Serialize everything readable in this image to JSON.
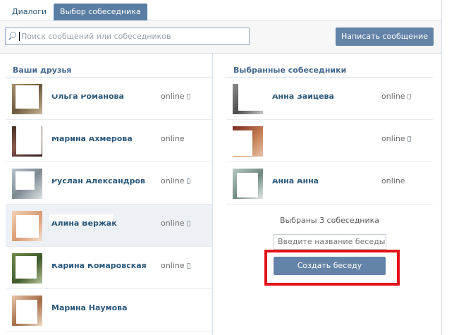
{
  "tabs": [
    {
      "label": "Диалоги",
      "active": false
    },
    {
      "label": "Выбор собеседника",
      "active": true
    }
  ],
  "search": {
    "placeholder": "Поиск сообщений или собеседников"
  },
  "toolbar": {
    "write_label": "Написать сообщение"
  },
  "friends": {
    "heading": "Ваши друзья",
    "items": [
      {
        "name": "Ольга Романова",
        "status": "online",
        "mobile": true,
        "selected": false
      },
      {
        "name": "Марина Ахмерова",
        "status": "online",
        "mobile": false,
        "selected": false
      },
      {
        "name": "Руслан Александров",
        "status": "online",
        "mobile": true,
        "selected": false
      },
      {
        "name": "Алина Вержак",
        "status": "online",
        "mobile": true,
        "selected": true
      },
      {
        "name": "Карина Комаровская",
        "status": "online",
        "mobile": true,
        "selected": false
      },
      {
        "name": "Марина Наумова",
        "status": "",
        "mobile": false,
        "selected": false
      }
    ]
  },
  "selected": {
    "heading": "Выбранные собеседники",
    "items": [
      {
        "name": "Анна Зайцева",
        "status": "online",
        "mobile": true
      },
      {
        "name": "",
        "status": "online",
        "mobile": true
      },
      {
        "name": "Анна Анна",
        "status": "online",
        "mobile": false
      }
    ],
    "summary": "Выбраны 3 собеседника",
    "chat_name_placeholder": "Введите название беседы",
    "create_label": "Создать беседу"
  },
  "colors": {
    "accent": "#597da3",
    "button": "#6383a8",
    "link": "#2b587a",
    "highlight": "#e3121b"
  }
}
